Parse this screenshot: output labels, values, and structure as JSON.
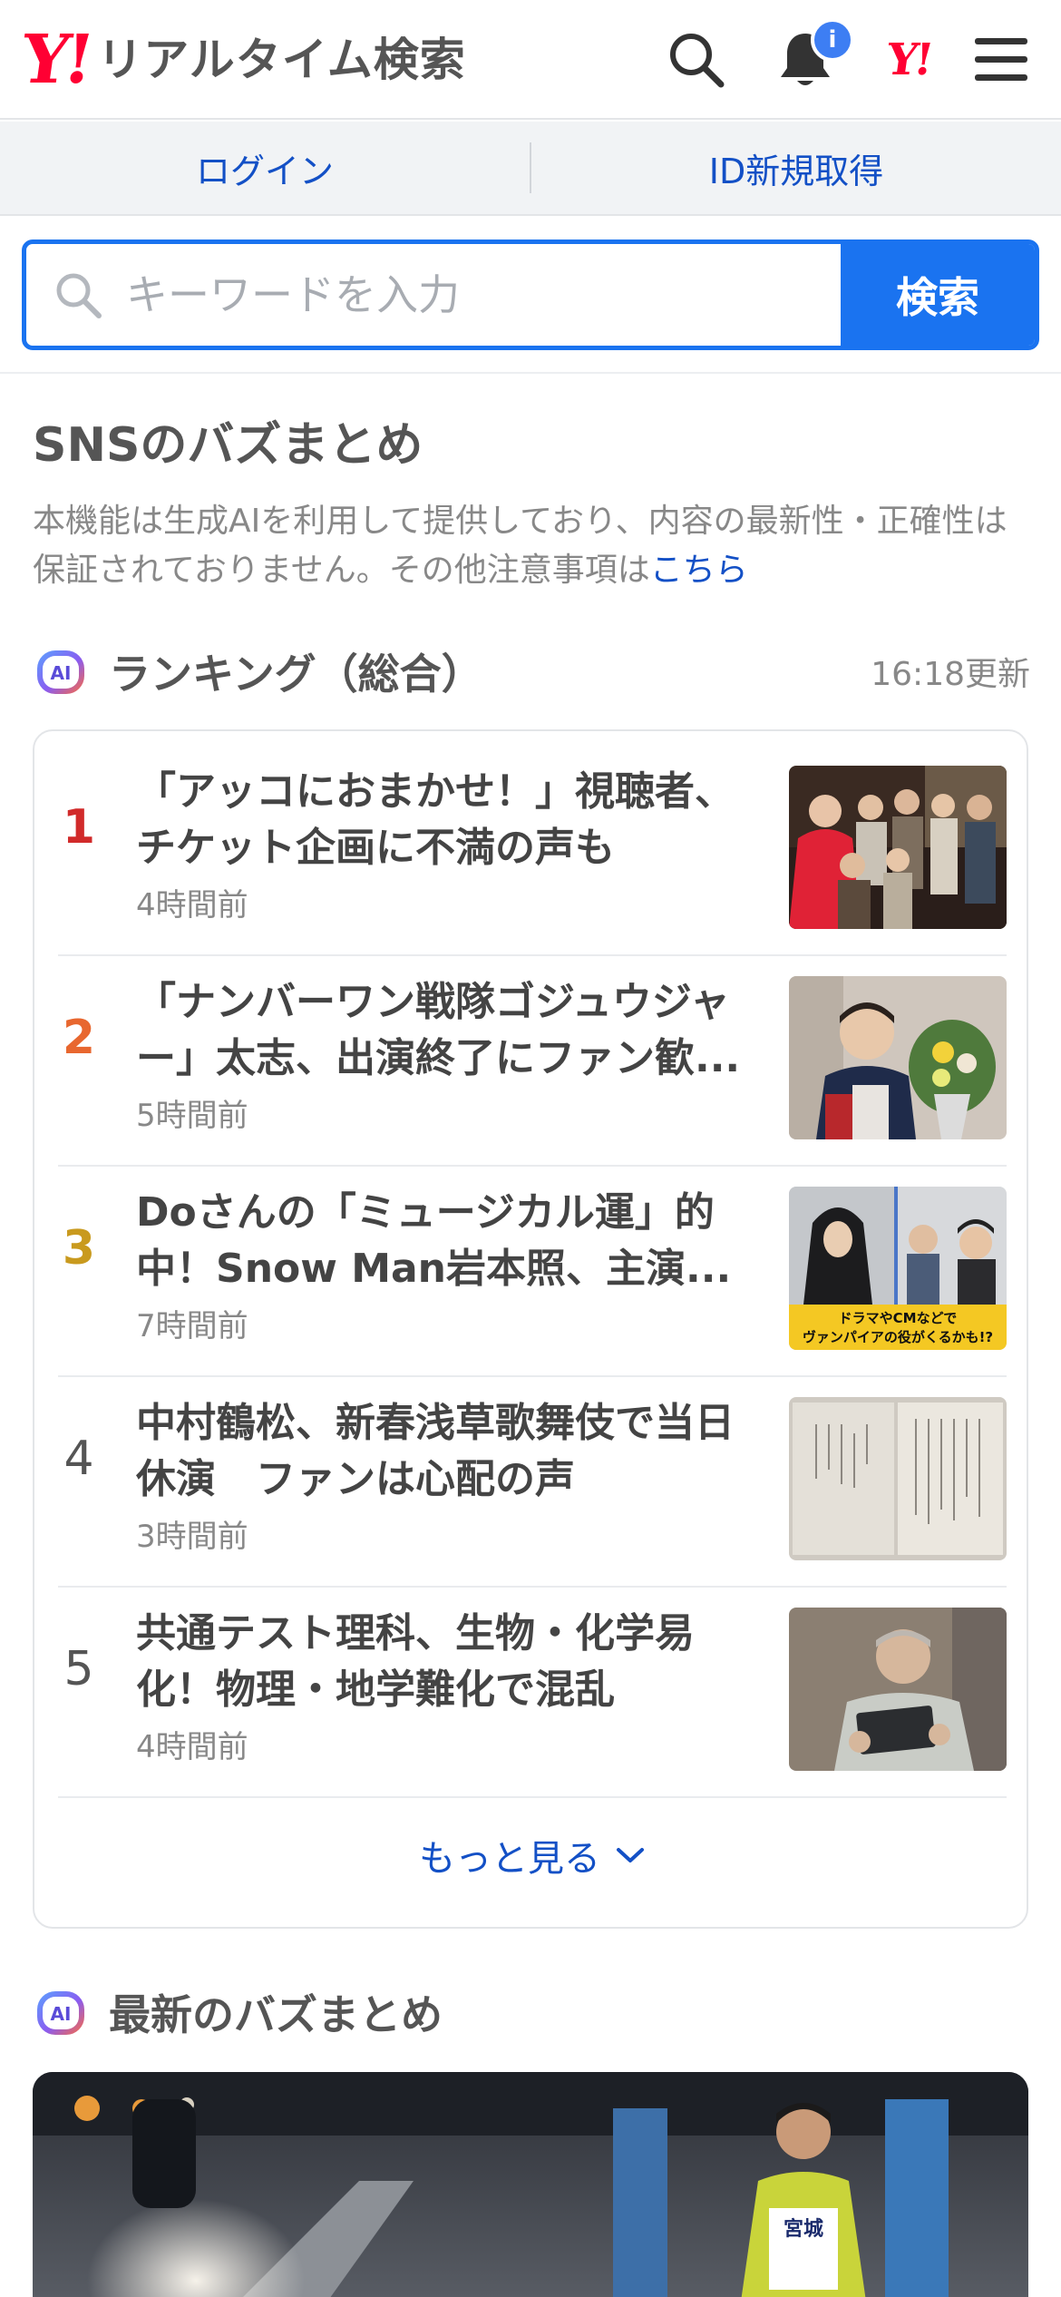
{
  "header": {
    "logo_mark": "Y!",
    "logo_text": "リアルタイム検索",
    "notification_badge": "i",
    "yj_mark": "Y!"
  },
  "account": {
    "login_label": "ログイン",
    "signup_label": "ID新規取得"
  },
  "search": {
    "placeholder": "キーワードを入力",
    "button_label": "検索"
  },
  "buzz": {
    "title": "SNSのバズまとめ",
    "note": "本機能は生成AIを利用して提供しており、内容の最新性・正確性は保証されておりません。その他注意事項は",
    "note_link": "こちら"
  },
  "ranking": {
    "ai_label": "AI",
    "title": "ランキング（総合）",
    "updated": "16:18更新",
    "items": [
      {
        "rank": "1",
        "headline": "「アッコにおまかせ！」視聴者、チケット企画に不満の声も",
        "time": "4時間前",
        "rank_color": "#d12a2a"
      },
      {
        "rank": "2",
        "headline": "「ナンバーワン戦隊ゴジュウジャー」太志、出演終了にファン歓...",
        "time": "5時間前",
        "rank_color": "#e8672f"
      },
      {
        "rank": "3",
        "headline": "Doさんの「ミュージカル運」的中！Snow Man岩本照、主演...",
        "time": "7時間前",
        "rank_color": "#c99a1e"
      },
      {
        "rank": "4",
        "headline": "中村鶴松、新春浅草歌舞伎で当日休演　ファンは心配の声",
        "time": "3時間前",
        "rank_color": "#555555"
      },
      {
        "rank": "5",
        "headline": "共通テスト理科、生物・化学易化！物理・地学難化で混乱",
        "time": "4時間前",
        "rank_color": "#555555"
      }
    ],
    "more_label": "もっと見る",
    "thumb3_caption_1": "ドラマやCMなどで",
    "thumb3_caption_2": "ヴァンパイアの役がくるかも!?"
  },
  "latest": {
    "ai_label": "AI",
    "title": "最新のバズまとめ",
    "photo_bib_text": "宮城"
  },
  "colors": {
    "accent_blue": "#1a73f0",
    "link_blue": "#1350c6",
    "brand_red": "#ff0033"
  }
}
